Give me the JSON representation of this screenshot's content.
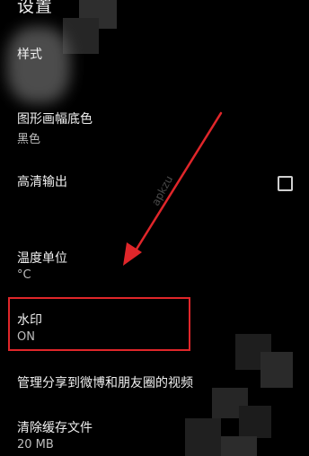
{
  "header": {
    "title": "设置"
  },
  "settings": [
    {
      "title": "样式",
      "value": ""
    },
    {
      "title": "图形画幅底色",
      "value": "黑色"
    },
    {
      "title": "高清输出",
      "value": ""
    },
    {
      "title": "温度单位",
      "value": "°C"
    },
    {
      "title": "水印",
      "value": "ON"
    },
    {
      "title": "管理分享到微博和朋友圈的视频",
      "value": ""
    },
    {
      "title": "清除缓存文件",
      "value": "20 MB"
    }
  ],
  "hd_output": {
    "checked": false
  },
  "overlay": {
    "watermark_text": "apkzu",
    "highlight_color": "#e0262a",
    "arrow_color": "#e0262a"
  }
}
